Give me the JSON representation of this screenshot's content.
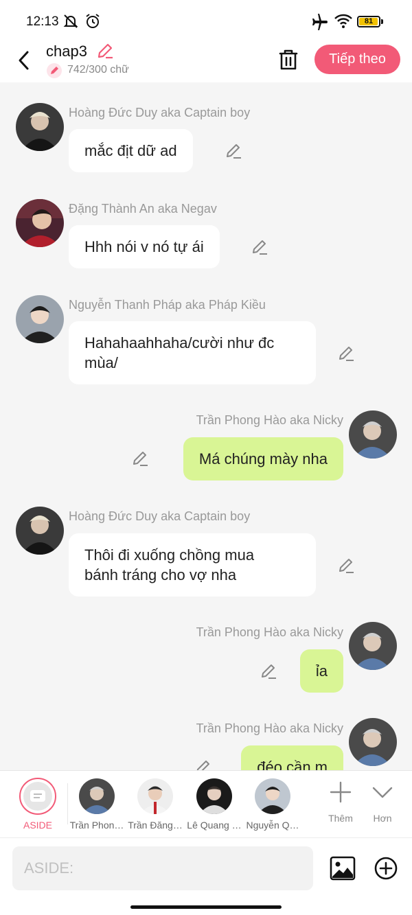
{
  "status_bar": {
    "time": "12:13",
    "battery": "81",
    "icons": [
      "notifications-muted-icon",
      "alarm-icon",
      "airplane-mode-icon",
      "wifi-icon",
      "battery-icon"
    ]
  },
  "header": {
    "title": "chap3",
    "word_count": "742/300 chữ",
    "next_label": "Tiếp theo"
  },
  "messages": [
    {
      "side": "in",
      "sender": "Hoàng Đức Duy aka Captain boy",
      "lines": [
        "mắc địt dữ ad"
      ]
    },
    {
      "side": "in",
      "sender": "Đặng Thành An aka Negav",
      "lines": [
        "Hhh nói v nó tự ái"
      ]
    },
    {
      "side": "in",
      "sender": "Nguyễn Thanh Pháp aka Pháp Kiều",
      "lines": [
        "Hahahaahhaha/cười như đc",
        "mùa/"
      ]
    },
    {
      "side": "out",
      "sender": "Trần Phong Hào aka Nicky",
      "lines": [
        "Má chúng mày nha"
      ]
    },
    {
      "side": "in",
      "sender": "Hoàng Đức Duy aka Captain boy",
      "lines": [
        "Thôi đi xuống chồng mua",
        "bánh tráng cho vợ nha"
      ]
    },
    {
      "side": "out",
      "sender": "Trần Phong Hào aka Nicky",
      "lines": [
        "ỉa"
      ]
    },
    {
      "side": "out",
      "sender": "Trần Phong Hào aka Nicky",
      "lines": [
        "đéo cần m"
      ]
    }
  ],
  "character_bar": {
    "aside_label": "ASIDE",
    "characters": [
      "Trần Phon…",
      "Trần Đăng…",
      "Lê Quang …",
      "Nguyễn Q…"
    ],
    "more_label": "Thêm",
    "less_label": "Hơn"
  },
  "input": {
    "placeholder": "ASIDE:"
  },
  "colors": {
    "accent": "#f25a77",
    "bubble_out": "#d9f595",
    "bubble_in": "#ffffff",
    "chat_background": "#f5f5f5"
  }
}
